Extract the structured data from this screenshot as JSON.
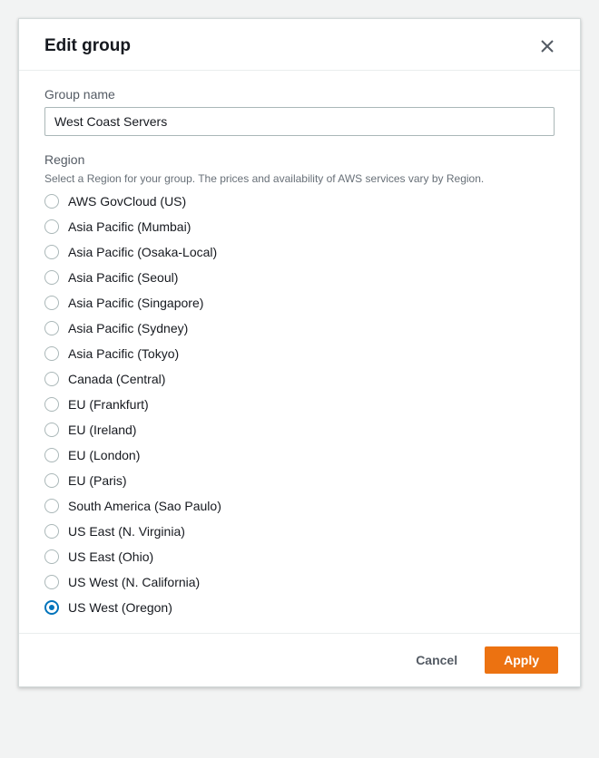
{
  "modal": {
    "title": "Edit group",
    "groupName": {
      "label": "Group name",
      "value": "West Coast Servers"
    },
    "region": {
      "label": "Region",
      "hint": "Select a Region for your group. The prices and availability of AWS services vary by Region.",
      "selected": "US West (Oregon)",
      "options": [
        "AWS GovCloud (US)",
        "Asia Pacific (Mumbai)",
        "Asia Pacific (Osaka-Local)",
        "Asia Pacific (Seoul)",
        "Asia Pacific (Singapore)",
        "Asia Pacific (Sydney)",
        "Asia Pacific (Tokyo)",
        "Canada (Central)",
        "EU (Frankfurt)",
        "EU (Ireland)",
        "EU (London)",
        "EU (Paris)",
        "South America (Sao Paulo)",
        "US East (N. Virginia)",
        "US East (Ohio)",
        "US West (N. California)",
        "US West (Oregon)"
      ]
    },
    "footer": {
      "cancel": "Cancel",
      "apply": "Apply"
    }
  }
}
